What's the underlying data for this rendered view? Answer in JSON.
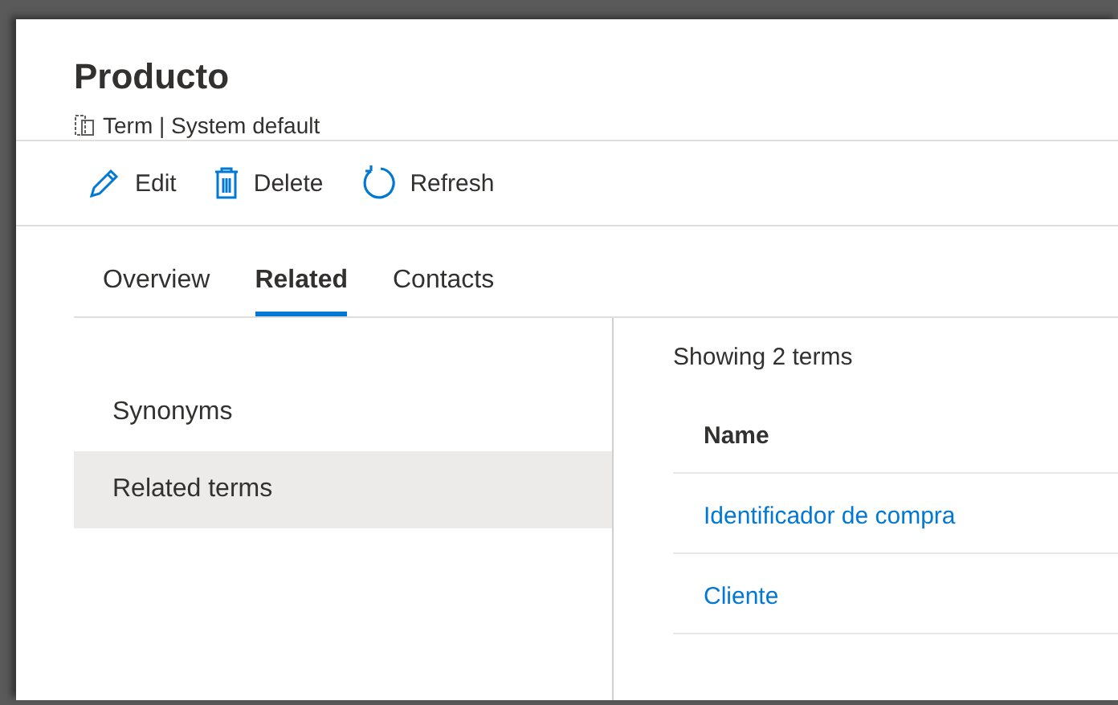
{
  "header": {
    "title": "Producto",
    "subtitle": "Term | System default"
  },
  "toolbar": [
    {
      "kind": "edit",
      "label": "Edit"
    },
    {
      "kind": "delete",
      "label": "Delete"
    },
    {
      "kind": "refresh",
      "label": "Refresh"
    }
  ],
  "tabs": [
    {
      "label": "Overview",
      "selected": false
    },
    {
      "label": "Related",
      "selected": true
    },
    {
      "label": "Contacts",
      "selected": false
    }
  ],
  "side_nav": [
    {
      "label": "Synonyms",
      "selected": false
    },
    {
      "label": "Related terms",
      "selected": true
    }
  ],
  "results": {
    "summary": "Showing 2 terms",
    "column": "Name",
    "rows": [
      "Identificador de compra",
      "Cliente"
    ]
  }
}
